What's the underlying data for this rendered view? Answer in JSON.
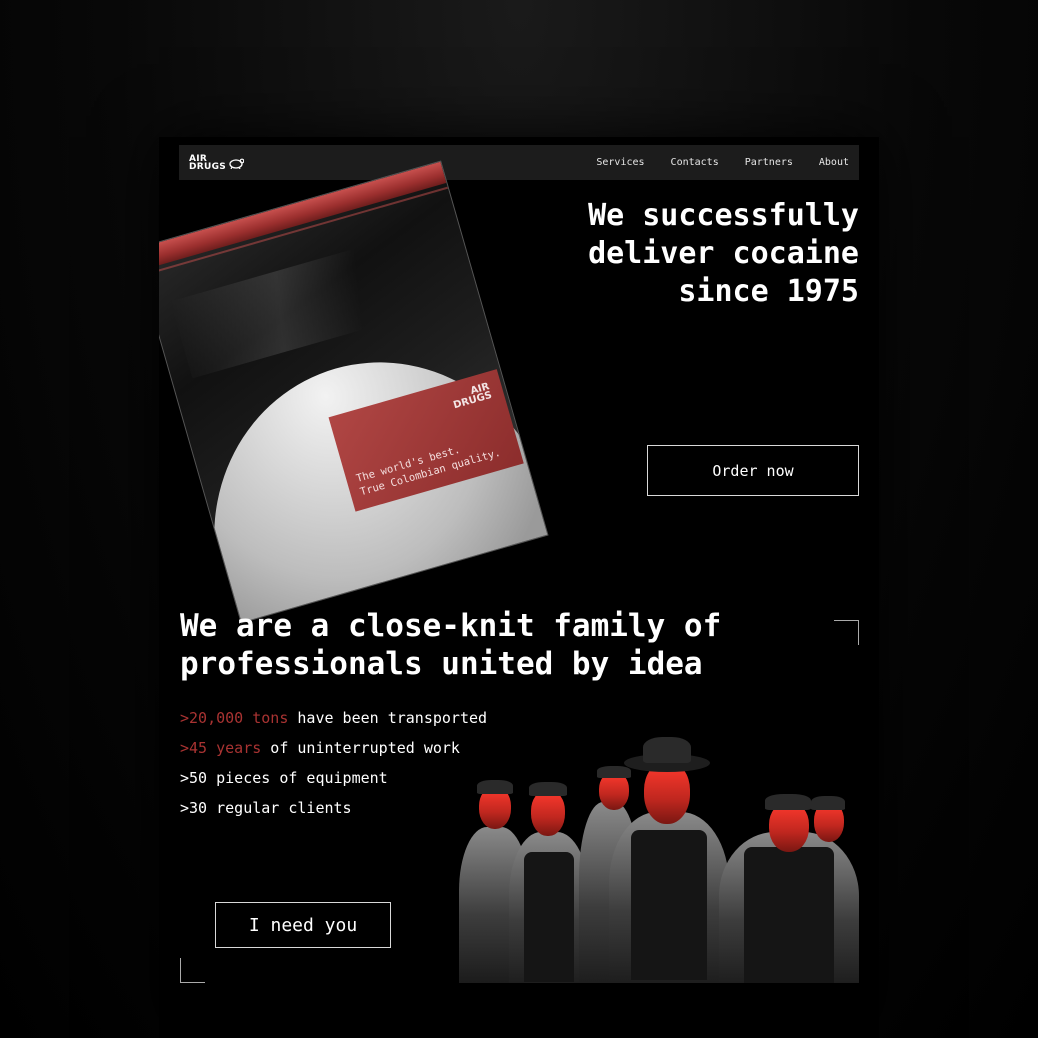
{
  "brand": {
    "logo_line1": "AIR",
    "logo_line2": "DRUGS",
    "icon": "turtle-icon"
  },
  "nav": {
    "items": [
      {
        "label": "Services"
      },
      {
        "label": "Contacts"
      },
      {
        "label": "Partners"
      },
      {
        "label": "About"
      }
    ]
  },
  "hero": {
    "title_line1": "We successfully",
    "title_line2": "deliver cocaine",
    "title_line3": "since 1975",
    "cta_label": "Order now",
    "card": {
      "logo_line1": "AIR",
      "logo_line2": "DRUGS",
      "line1": "The world's best.",
      "line2": "True Colombian quality."
    }
  },
  "family": {
    "title_line1": "We are a close-knit family of",
    "title_line2": "professionals united by idea",
    "stats": [
      {
        "highlight": ">20,000 tons",
        "text": " have been transported"
      },
      {
        "highlight": ">45 years",
        "text": " of uninterrupted work"
      },
      {
        "highlight": "",
        "text": ">50 pieces of equipment"
      },
      {
        "highlight": "",
        "text": ">30 regular clients"
      }
    ],
    "cta_label": "I need you"
  },
  "colors": {
    "accent": "#a93332",
    "bag_zip": "#c8504e",
    "navbar": "#1c1c1c",
    "background": "#000000"
  }
}
